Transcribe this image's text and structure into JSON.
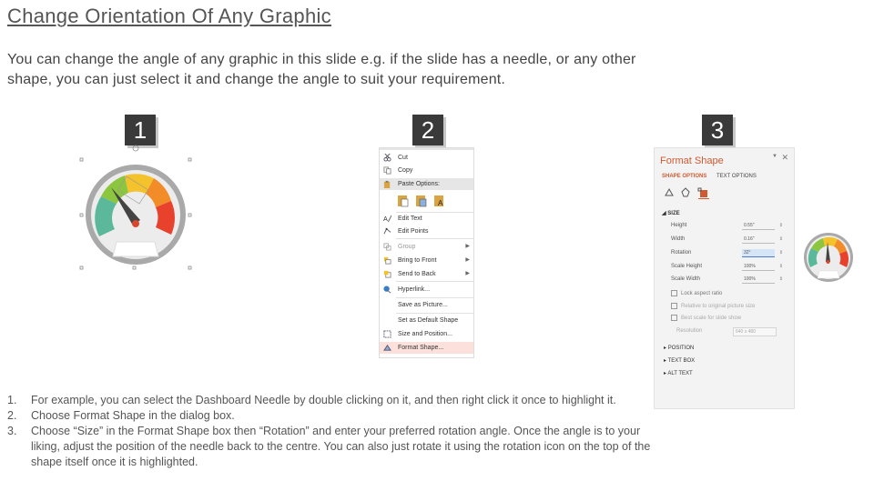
{
  "title": "Change Orientation Of Any Graphic",
  "intro": "You can change the angle of any graphic in this slide e.g. if the slide has a needle, or any other shape, you can just select it and change the angle to suit your requirement.",
  "badges": [
    "1",
    "2",
    "3"
  ],
  "context_menu": {
    "items": [
      {
        "label": "Cut",
        "icon": "scissors-icon"
      },
      {
        "label": "Copy",
        "icon": "copy-icon"
      },
      {
        "label": "Paste Options:",
        "icon": "paste-icon"
      },
      {
        "label": "Edit Text",
        "icon": "edit-text-icon"
      },
      {
        "label": "Edit Points",
        "icon": "edit-points-icon"
      },
      {
        "label": "Group",
        "icon": "group-icon"
      },
      {
        "label": "Bring to Front",
        "icon": "bring-front-icon"
      },
      {
        "label": "Send to Back",
        "icon": "send-back-icon"
      },
      {
        "label": "Hyperlink...",
        "icon": "hyperlink-icon"
      },
      {
        "label": "Save as Picture...",
        "icon": ""
      },
      {
        "label": "Set as Default Shape",
        "icon": ""
      },
      {
        "label": "Size and Position...",
        "icon": "size-position-icon"
      },
      {
        "label": "Format Shape...",
        "icon": "format-shape-icon"
      }
    ]
  },
  "format_pane": {
    "title": "Format Shape",
    "tabs": [
      "SHAPE OPTIONS",
      "TEXT OPTIONS"
    ],
    "section": "SIZE",
    "rows": [
      {
        "label": "Height",
        "value": "0.55\""
      },
      {
        "label": "Width",
        "value": "0.16\""
      },
      {
        "label": "Rotation",
        "value": "32°"
      },
      {
        "label": "Scale Height",
        "value": "100%"
      },
      {
        "label": "Scale Width",
        "value": "100%"
      }
    ],
    "checks": [
      "Lock aspect ratio",
      "Relative to original picture size",
      "Best scale for slide show"
    ],
    "resolution": {
      "label": "Resolution",
      "value": "640 x 480"
    },
    "collapsed": [
      "POSITION",
      "TEXT BOX",
      "ALT TEXT"
    ]
  },
  "steps": [
    {
      "num": "1.",
      "text": "For example, you can select the Dashboard Needle by double clicking on it, and then right click it once to highlight it."
    },
    {
      "num": "2.",
      "text": "Choose Format Shape in the dialog box."
    },
    {
      "num": "3.",
      "text": "Choose “Size” in the Format Shape box then “Rotation” and enter your preferred rotation angle. Once the angle is to your liking, adjust the position of the needle back to the centre. You can also just rotate it using the rotation icon on the top of the shape itself once it is highlighted."
    }
  ],
  "colors": {
    "gauge_green": "#8cc63f",
    "gauge_teal": "#5bb89b",
    "gauge_yellow": "#f4c22b",
    "gauge_orange": "#f28c28",
    "gauge_red": "#e8412c",
    "pane_accent": "#d05a32"
  }
}
